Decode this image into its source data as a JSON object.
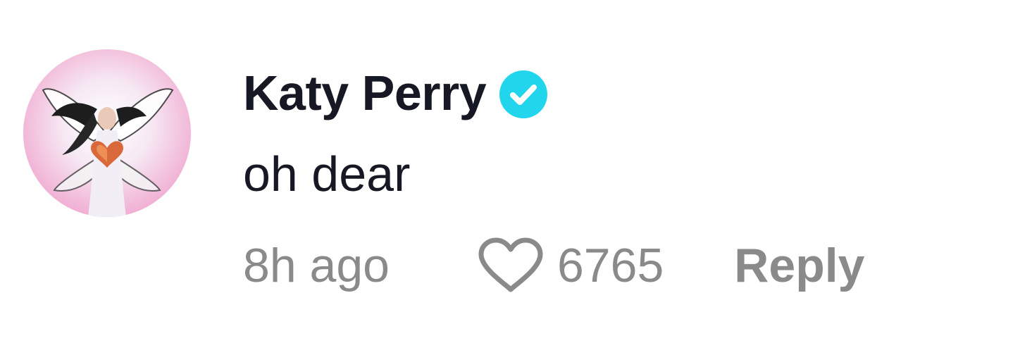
{
  "comment": {
    "author": {
      "name": "Katy Perry",
      "verified": true,
      "avatar_icon": "profile-photo"
    },
    "text": "oh dear",
    "timestamp": "8h ago",
    "likes": "6765",
    "reply_label": "Reply"
  },
  "icons": {
    "verified": "verified-badge-icon",
    "like": "heart-outline-icon"
  },
  "colors": {
    "name_text": "#161823",
    "meta_text": "#8a8a8a",
    "verified_badge": "#20d5ec"
  }
}
